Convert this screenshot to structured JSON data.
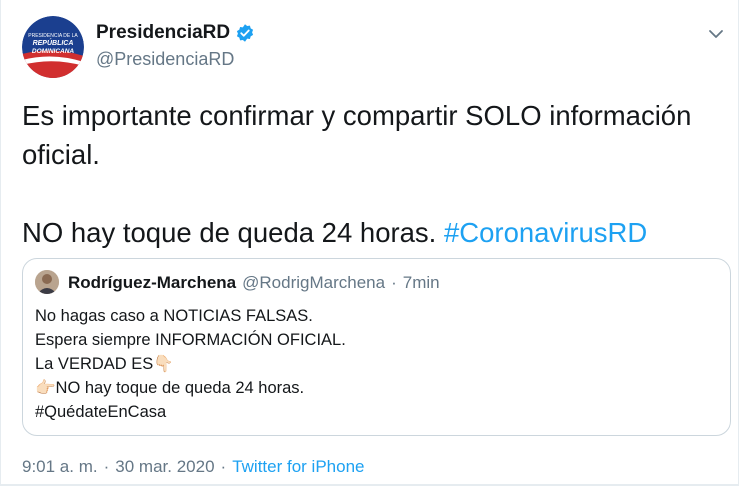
{
  "tweet": {
    "display_name": "PresidenciaRD",
    "handle": "@PresidenciaRD",
    "avatar_text": "PRESIDENCIA DE LA REPÚBLICA DOMINICANA",
    "line1": "Es importante confirmar y compartir SOLO información oficial.",
    "line2": "NO hay toque de queda 24 horas.",
    "hashtag": "#CoronavirusRD",
    "quote": {
      "display_name": "Rodríguez-Marchena",
      "handle": "@RodrigMarchena",
      "separator": "·",
      "time": "7min",
      "lines": [
        "No hagas caso a NOTICIAS FALSAS.",
        "Espera siempre INFORMACIÓN OFICIAL.",
        "La VERDAD ES👇🏻",
        "👉🏻NO hay toque de queda 24 horas.",
        "#QuédateEnCasa"
      ]
    },
    "footer": {
      "time": "9:01 a. m.",
      "sep1": "·",
      "date": "30 mar. 2020",
      "sep2": "·",
      "source": "Twitter for iPhone"
    }
  },
  "colors": {
    "accent": "#1da1f2",
    "secondary_text": "#657786",
    "border": "#ccd6dd"
  },
  "icons": {
    "verified": "verified-badge-icon",
    "caret": "chevron-down-icon"
  }
}
